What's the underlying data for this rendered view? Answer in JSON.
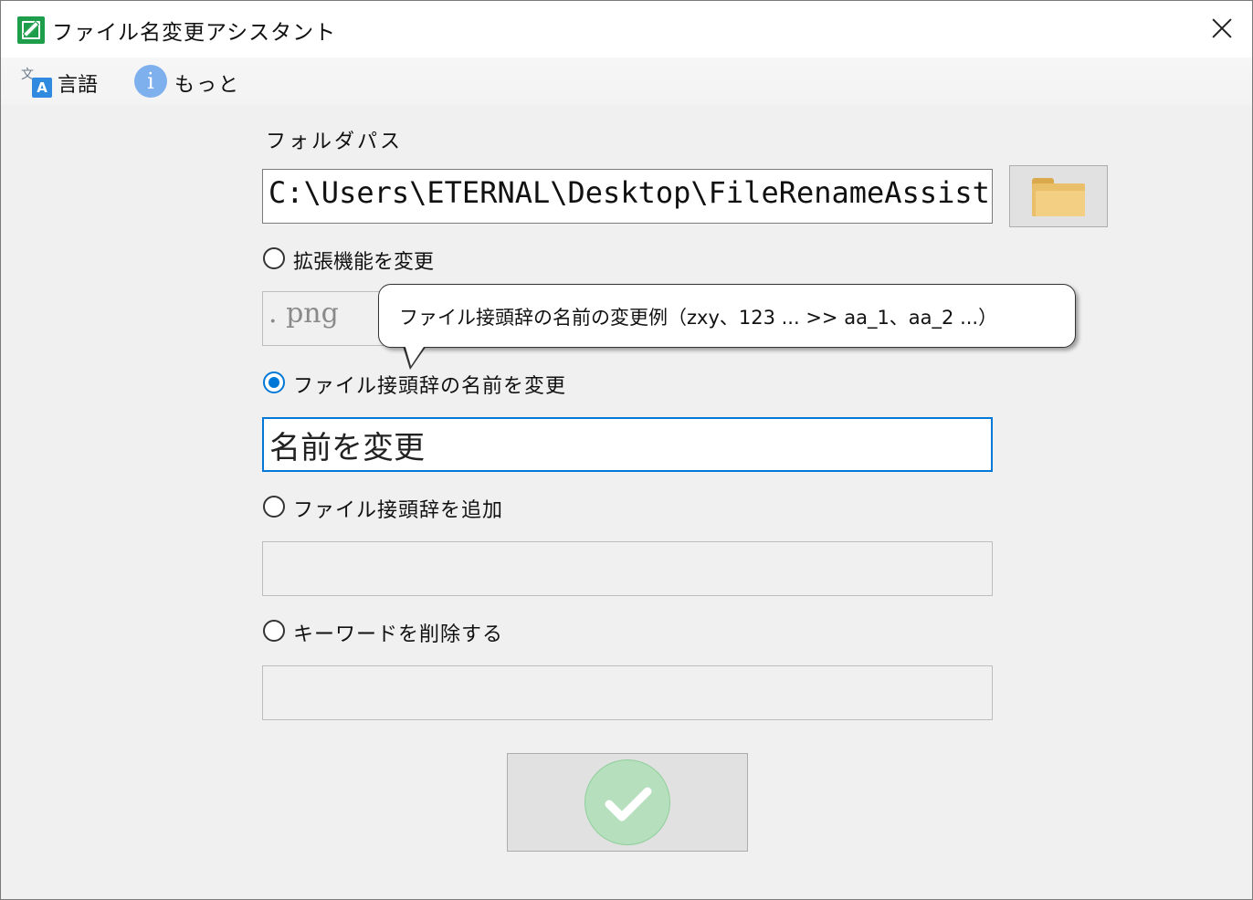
{
  "window": {
    "title": "ファイル名変更アシスタント"
  },
  "menu": {
    "language": "言語",
    "more": "もっと",
    "lang_icon_a": "A",
    "lang_icon_b": "文",
    "info_icon_glyph": "i"
  },
  "form": {
    "folder_label": "フォルダパス",
    "folder_path": "C:\\Users\\ETERNAL\\Desktop\\FileRenameAssistant",
    "options": [
      {
        "label": "拡張機能を変更",
        "checked": false
      },
      {
        "label": "ファイル接頭辞の名前を変更",
        "checked": true
      },
      {
        "label": "ファイル接頭辞を追加",
        "checked": false
      },
      {
        "label": "キーワードを削除する",
        "checked": false
      }
    ],
    "extension_placeholder": ". png",
    "rename_value": "名前を変更",
    "prefix_value": "",
    "delete_value": ""
  },
  "tooltip": {
    "text": "ファイル接頭辞の名前の変更例（zxy、123 ... >> aa_1、aa_2 ...）"
  },
  "icons": {
    "app": "rename-app-icon",
    "close": "close-icon",
    "language": "translate-icon",
    "more": "info-icon",
    "browse": "folder-icon",
    "confirm": "checkmark-icon"
  },
  "colors": {
    "accent": "#0078d7",
    "confirm": "#b6e0bd",
    "app_icon": "#1e9e4a"
  }
}
